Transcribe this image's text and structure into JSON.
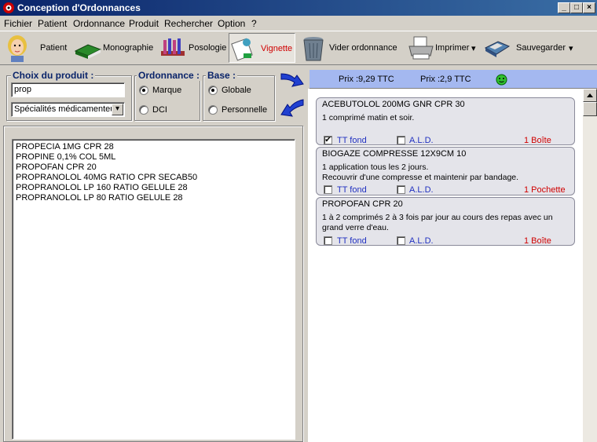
{
  "window": {
    "title": "Conception d'Ordonnances",
    "min_label": "_",
    "max_label": "□",
    "close_label": "×"
  },
  "menu": [
    {
      "label": "Fichier"
    },
    {
      "label": "Patient"
    },
    {
      "label": "Ordonnance"
    },
    {
      "label": "Produit"
    },
    {
      "label": "Rechercher"
    },
    {
      "label": "Option"
    },
    {
      "label": "?"
    }
  ],
  "toolbar": {
    "patient": "Patient",
    "monographie": "Monographie",
    "posologie": "Posologie",
    "vignette": "Vignette",
    "vider": "Vider ordonnance",
    "imprimer": "Imprimer",
    "sauvegarder": "Sauvegarder",
    "dropdown": "▾"
  },
  "choix": {
    "title": "Choix du produit :",
    "search_value": "prop",
    "category_value": "Spécialités médicamenteu",
    "combo_arrow": "▾"
  },
  "ordonnance": {
    "title": "Ordonnance :",
    "opt1": "Marque",
    "opt2": "DCI",
    "selected": "Marque"
  },
  "base": {
    "title": "Base :",
    "opt1": "Globale",
    "opt2": "Personnelle",
    "selected": "Globale"
  },
  "results": [
    "PROPECIA 1MG CPR 28",
    "PROPINE 0,1% COL 5ML",
    "PROPOFAN CPR 20",
    "PROPRANOLOL 40MG RATIO CPR SECAB50",
    "PROPRANOLOL LP 160 RATIO GELULE 28",
    "PROPRANOLOL LP 80 RATIO GELULE 28"
  ],
  "prices": {
    "price1": "Prix :9,29 TTC",
    "price2": "Prix :2,9 TTC"
  },
  "prescription": [
    {
      "name": "ACEBUTOLOL 200MG GNR CPR 30",
      "posology": "1 comprimé matin et soir.",
      "tt_label": "TT fond",
      "tt_checked": "✔",
      "ald_label": "A.L.D.",
      "quantity": "1 Boîte"
    },
    {
      "name": "BIOGAZE COMPRESSE 12X9CM 10",
      "posology": "1 application tous les 2 jours.\nRecouvrir d'une compresse et maintenir par bandage.",
      "tt_label": "TT fond",
      "tt_checked": "",
      "ald_label": "A.L.D.",
      "quantity": "1 Pochette"
    },
    {
      "name": "PROPOFAN CPR 20",
      "posology": "1 à 2 comprimés 2 à 3 fois par jour au cours des repas avec un grand verre d'eau.",
      "tt_label": "TT fond",
      "tt_checked": "",
      "ald_label": "A.L.D.",
      "quantity": "1 Boîte"
    }
  ],
  "colors": {
    "title_bar": "#0a246a",
    "label_blue": "#0a246a",
    "qty_red": "#d00000",
    "price_bar": "#a4b8f0"
  }
}
